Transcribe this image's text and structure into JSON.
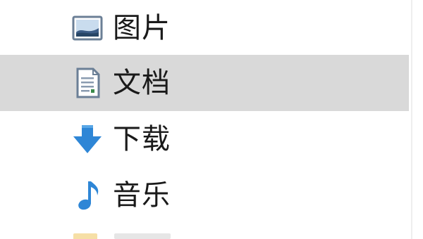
{
  "nav": {
    "items": [
      {
        "label": "图片",
        "icon": "pictures-icon",
        "selected": false
      },
      {
        "label": "文档",
        "icon": "documents-icon",
        "selected": true
      },
      {
        "label": "下载",
        "icon": "downloads-icon",
        "selected": false
      },
      {
        "label": "音乐",
        "icon": "music-icon",
        "selected": false
      }
    ]
  },
  "colors": {
    "selected_bg": "#d9d9d9",
    "download_arrow": "#2e86d6",
    "music_note": "#2e86d6",
    "text": "#1a1a1a"
  }
}
